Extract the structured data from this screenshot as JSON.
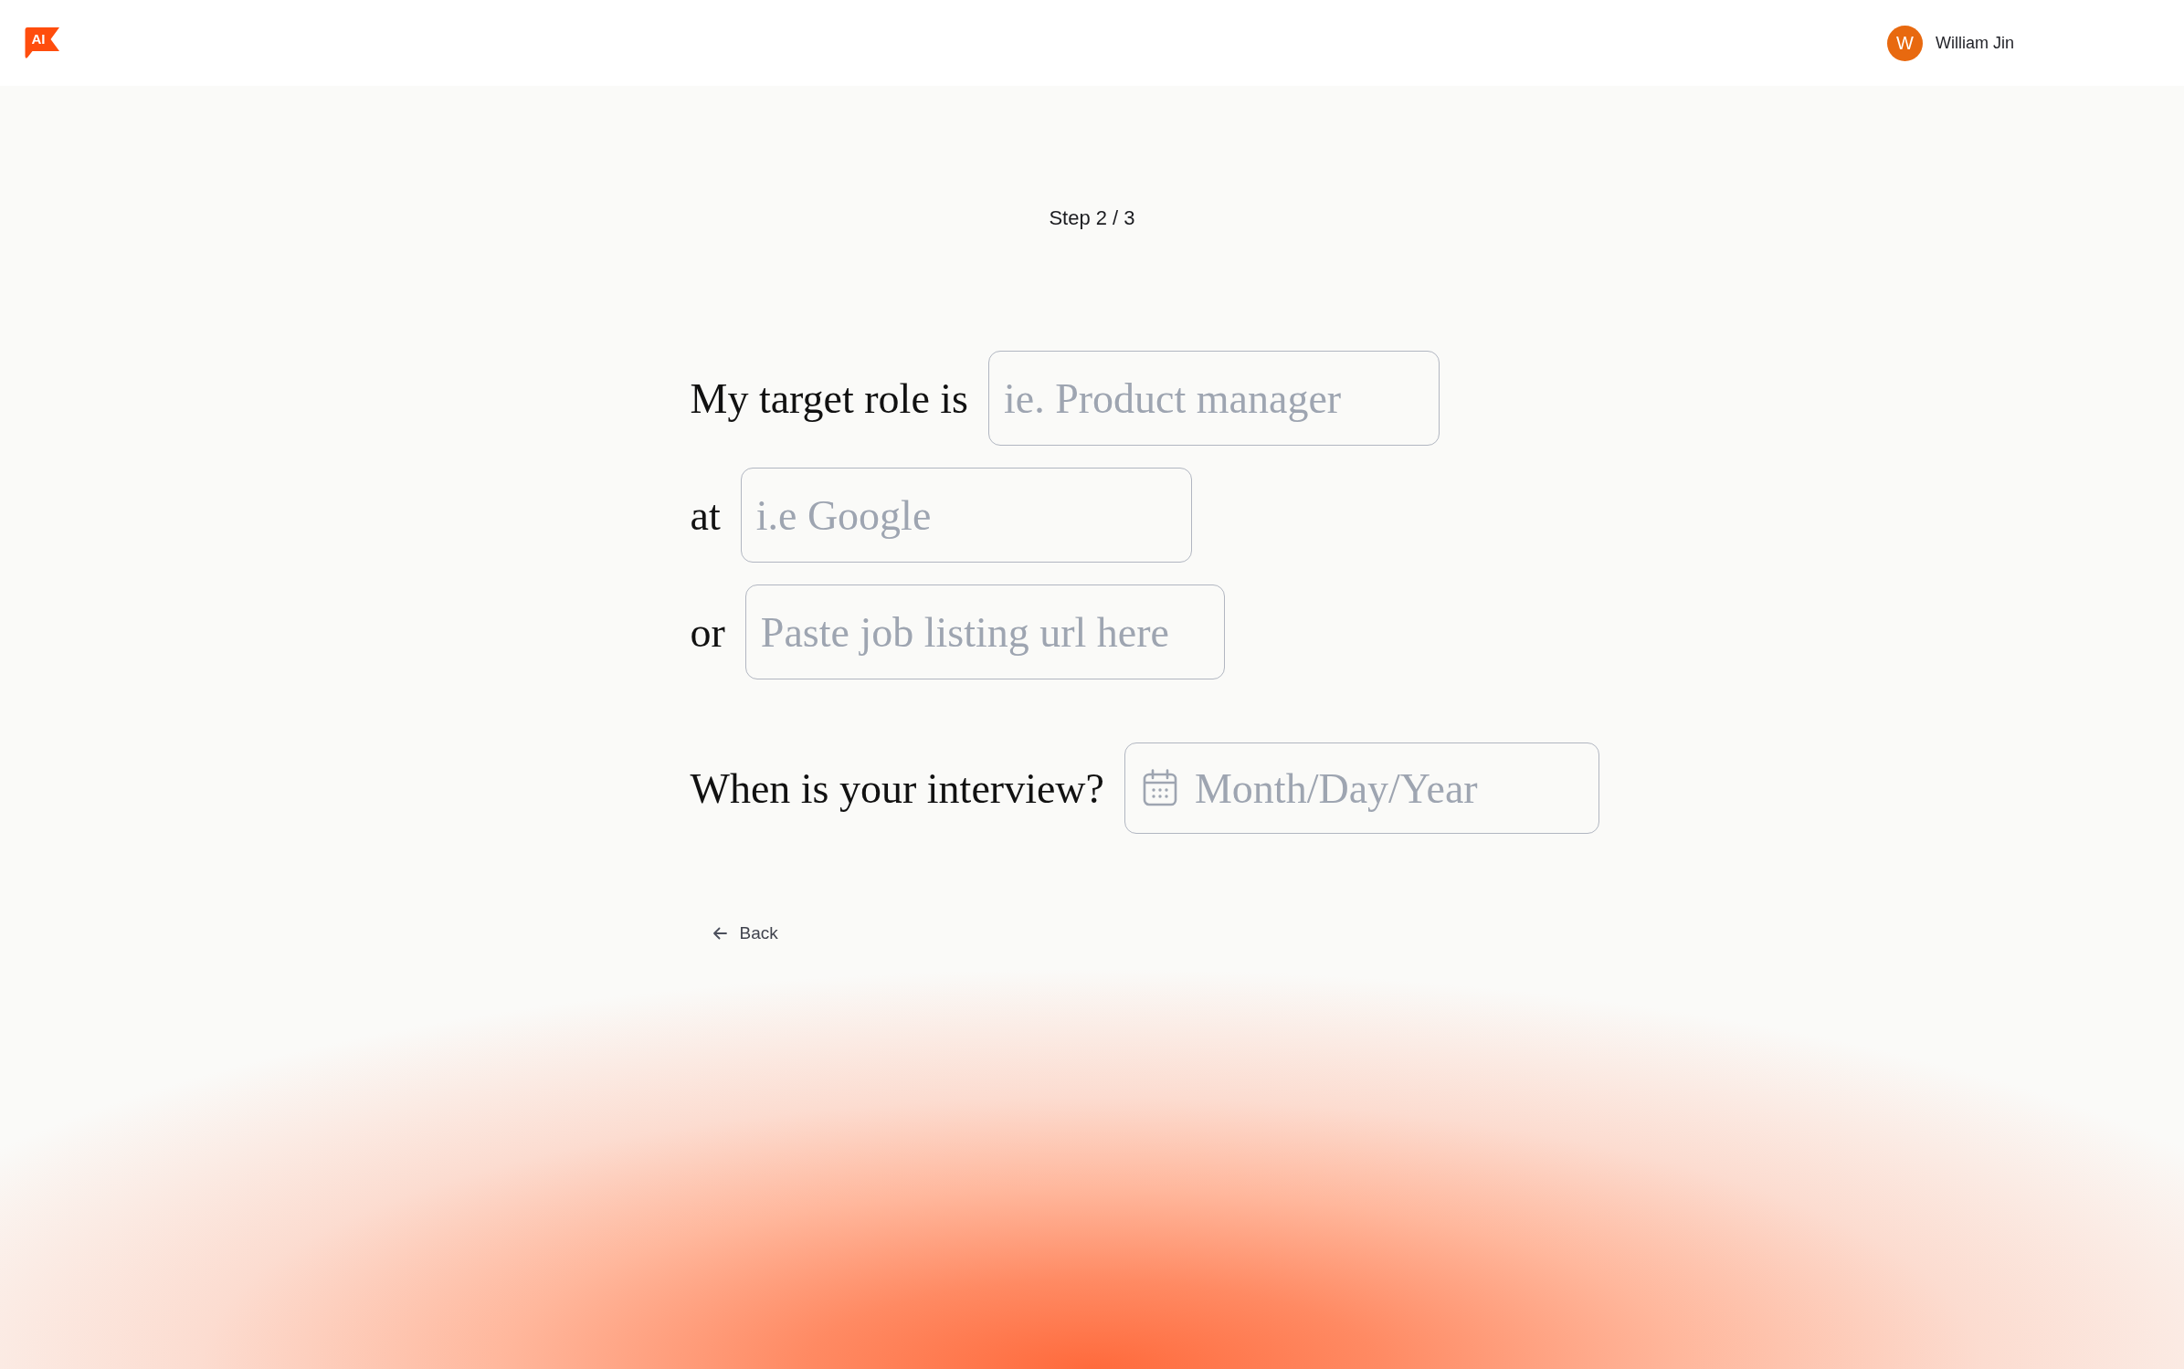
{
  "header": {
    "logo_text": "AI",
    "user": {
      "initial": "W",
      "name": "William Jin"
    }
  },
  "step": "Step 2 / 3",
  "fields": [
    {
      "kind": "text",
      "label": "My target role is",
      "placeholder": "ie. Product manager"
    },
    {
      "kind": "text",
      "label": "at",
      "placeholder": "i.e Google"
    },
    {
      "kind": "text",
      "label": "or",
      "placeholder": "Paste job listing url here"
    },
    {
      "kind": "date",
      "label": "When is your interview?",
      "placeholder": "Month/Day/Year"
    }
  ],
  "back_button": {
    "label": "Back"
  }
}
